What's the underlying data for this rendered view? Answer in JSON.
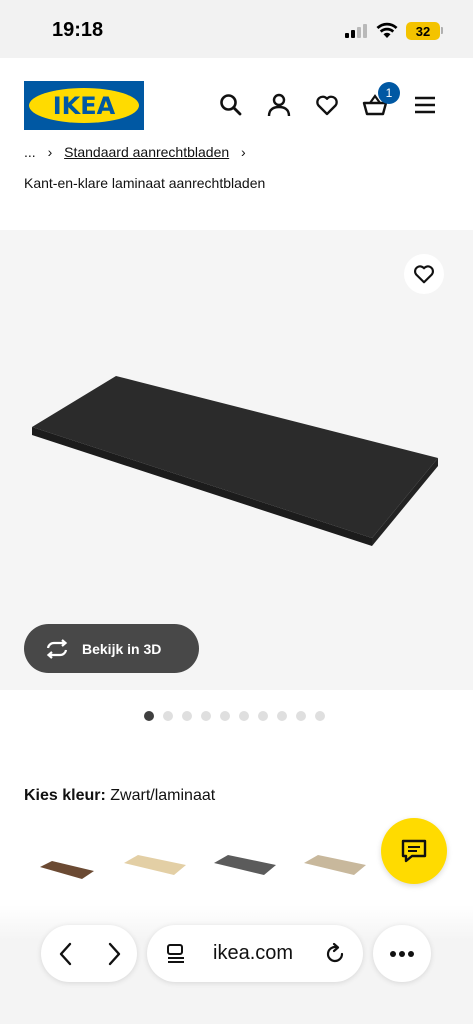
{
  "status_bar": {
    "time": "19:18",
    "battery": "32"
  },
  "header": {
    "logo_text": "IKEA",
    "cart_count": "1"
  },
  "breadcrumb": {
    "ellipsis": "...",
    "separator": "›",
    "category": "Standaard aanrechtbladen"
  },
  "product": {
    "subtitle": "Kant-en-klare laminaat aanrechtbladen",
    "view_3d_label": "Bekijk in 3D"
  },
  "carousel": {
    "total": 10,
    "active_index": 0
  },
  "colour": {
    "label": "Kies kleur:",
    "value": "Zwart/laminaat"
  },
  "swatches": [
    {
      "name": "walnut",
      "color": "#6b4a33"
    },
    {
      "name": "birch",
      "color": "#e3cfa5"
    },
    {
      "name": "anthracite",
      "color": "#5b5b5b"
    },
    {
      "name": "oak-beige",
      "color": "#c8b89c"
    }
  ],
  "browser": {
    "url": "ikea.com"
  },
  "colors": {
    "ikea_blue": "#0058a3",
    "ikea_yellow": "#ffdb00"
  }
}
